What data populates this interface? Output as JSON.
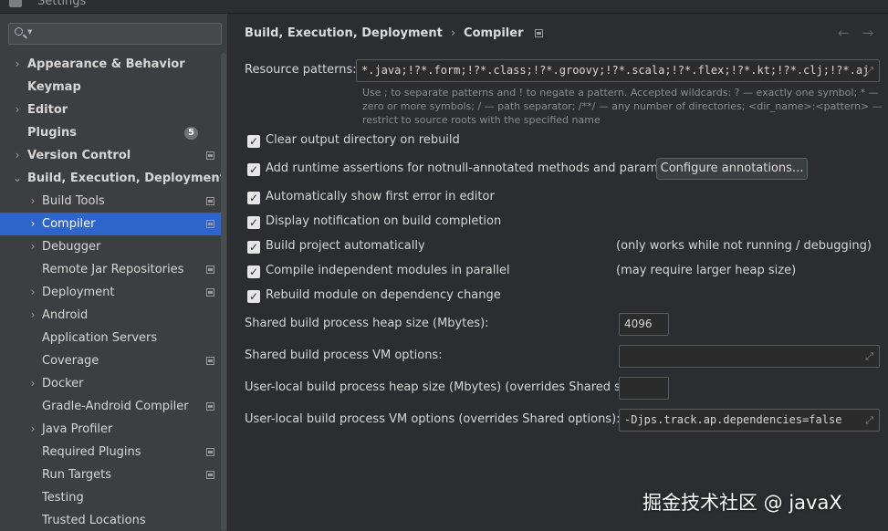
{
  "window": {
    "title": "Settings"
  },
  "search": {
    "placeholder": "",
    "value": ""
  },
  "sidebar": {
    "items": [
      {
        "label": "Appearance & Behavior",
        "arrow": "›",
        "bold": true
      },
      {
        "label": "Keymap",
        "bold": true
      },
      {
        "label": "Editor",
        "arrow": "›",
        "bold": true
      },
      {
        "label": "Plugins",
        "bold": true,
        "badge": "5"
      },
      {
        "label": "Version Control",
        "arrow": "›",
        "bold": true,
        "project_icon": true
      },
      {
        "label": "Build, Execution, Deployment",
        "arrow": "⌄",
        "bold": true
      },
      {
        "label": "Build Tools",
        "arrow": "›",
        "project_icon": true
      },
      {
        "label": "Compiler",
        "arrow": "›",
        "project_icon": true,
        "selected": true
      },
      {
        "label": "Debugger",
        "arrow": "›"
      },
      {
        "label": "Remote Jar Repositories",
        "project_icon": true
      },
      {
        "label": "Deployment",
        "arrow": "›",
        "project_icon": true
      },
      {
        "label": "Android",
        "arrow": "›"
      },
      {
        "label": "Application Servers"
      },
      {
        "label": "Coverage",
        "project_icon": true
      },
      {
        "label": "Docker",
        "arrow": "›"
      },
      {
        "label": "Gradle-Android Compiler",
        "project_icon": true
      },
      {
        "label": "Java Profiler",
        "arrow": "›"
      },
      {
        "label": "Required Plugins",
        "project_icon": true
      },
      {
        "label": "Run Targets",
        "project_icon": true
      },
      {
        "label": "Testing"
      },
      {
        "label": "Trusted Locations"
      }
    ]
  },
  "breadcrumb": {
    "parent": "Build, Execution, Deployment",
    "separator": "›",
    "current": "Compiler"
  },
  "nav": {
    "back": "←",
    "forward": "→"
  },
  "resource_patterns": {
    "label": "Resource patterns:",
    "value": "*.java;!?*.form;!?*.class;!?*.groovy;!?*.scala;!?*.flex;!?*.kt;!?*.clj;!?*.aj",
    "help": "Use ; to separate patterns and ! to negate a pattern. Accepted wildcards: ? — exactly one symbol; * — zero or more symbols; / — path separator; /**/ — any number of directories; <dir_name>:<pattern> — restrict to source roots with the specified name"
  },
  "options": [
    {
      "label": "Clear output directory on rebuild",
      "checked": true
    },
    {
      "label": "Add runtime assertions for notnull-annotated methods and parameters",
      "checked": true
    },
    {
      "label": "Automatically show first error in editor",
      "checked": true
    },
    {
      "label": "Display notification on build completion",
      "checked": true
    },
    {
      "label": "Build project automatically",
      "checked": true,
      "note": "(only works while not running / debugging)"
    },
    {
      "label": "Compile independent modules in parallel",
      "checked": true,
      "note": "(may require larger heap size)"
    },
    {
      "label": "Rebuild module on dependency change",
      "checked": true
    }
  ],
  "configure_button": "Configure annotations...",
  "fields": {
    "shared_heap": {
      "label": "Shared build process heap size (Mbytes):",
      "value": "4096"
    },
    "shared_vm": {
      "label": "Shared build process VM options:",
      "value": ""
    },
    "user_heap": {
      "label": "User-local build process heap size (Mbytes) (overrides Shared size):",
      "value": ""
    },
    "user_vm": {
      "label": "User-local build process VM options (overrides Shared options):",
      "value": "-Djps.track.ap.dependencies=false"
    }
  },
  "watermark": "掘金技术社区 @ javaX"
}
